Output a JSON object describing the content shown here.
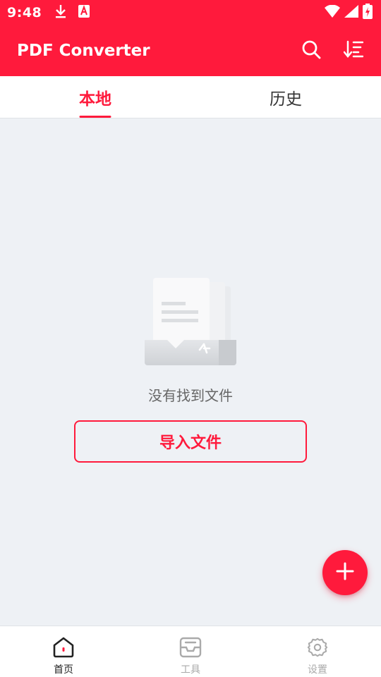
{
  "status_bar": {
    "time": "9:48",
    "left_icons": [
      "download-icon",
      "app-notification-icon"
    ],
    "right_icons": [
      "wifi-icon",
      "signal-icon",
      "battery-charging-icon"
    ]
  },
  "app_bar": {
    "title": "PDF Converter",
    "actions": [
      "search-icon",
      "sort-icon"
    ]
  },
  "tabs": [
    {
      "label": "本地",
      "active": true
    },
    {
      "label": "历史",
      "active": false
    }
  ],
  "empty_state": {
    "illustration": "empty-folder-icon",
    "message": "没有找到文件",
    "import_button": "导入文件"
  },
  "fab": {
    "icon": "plus-icon"
  },
  "bottom_nav": [
    {
      "label": "首页",
      "icon": "home-icon",
      "active": true
    },
    {
      "label": "工具",
      "icon": "tray-icon",
      "active": false
    },
    {
      "label": "设置",
      "icon": "gear-icon",
      "active": false
    }
  ],
  "colors": {
    "primary": "#ff1a3c",
    "background": "#eef1f5",
    "surface": "#ffffff",
    "text_secondary": "#666666",
    "nav_inactive": "#aaaaaa"
  }
}
